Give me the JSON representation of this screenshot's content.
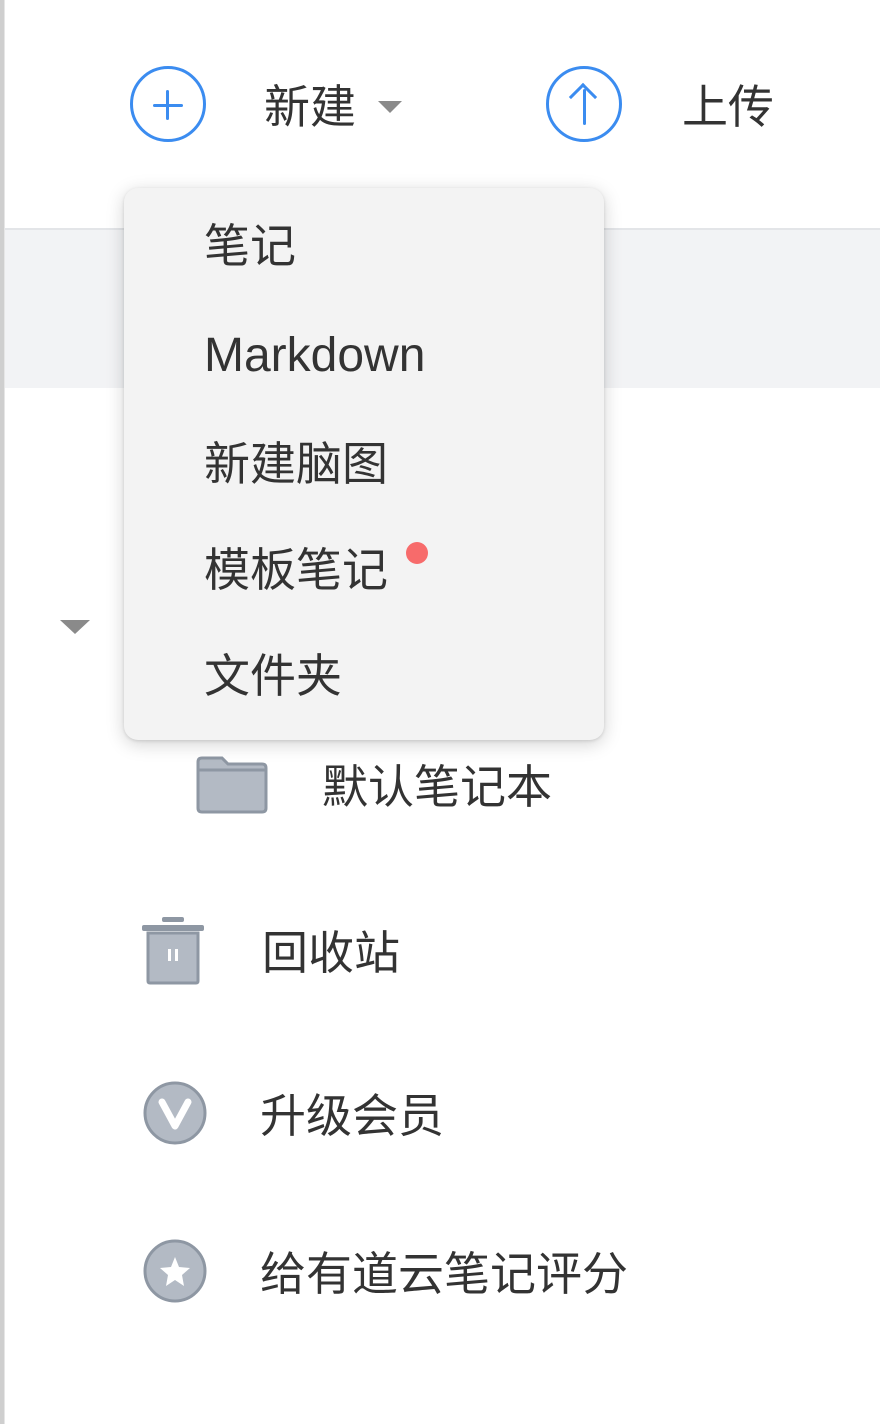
{
  "toolbar": {
    "new_label": "新建",
    "upload_label": "上传"
  },
  "dropdown": {
    "items": [
      {
        "label": "笔记"
      },
      {
        "label": "Markdown"
      },
      {
        "label": "新建脑图"
      },
      {
        "label": "模板笔记",
        "badge": "new-dot"
      },
      {
        "label": "文件夹"
      }
    ]
  },
  "sidebar": {
    "notebook_label": "默认笔记本",
    "trash_label": "回收站",
    "vip_label": "升级会员",
    "rate_label": "给有道云笔记评分"
  },
  "colors": {
    "accent": "#3b8cf0",
    "icon_grey": "#a5adb8",
    "badge_red": "#f76b6b",
    "menu_bg": "#f3f3f3"
  }
}
